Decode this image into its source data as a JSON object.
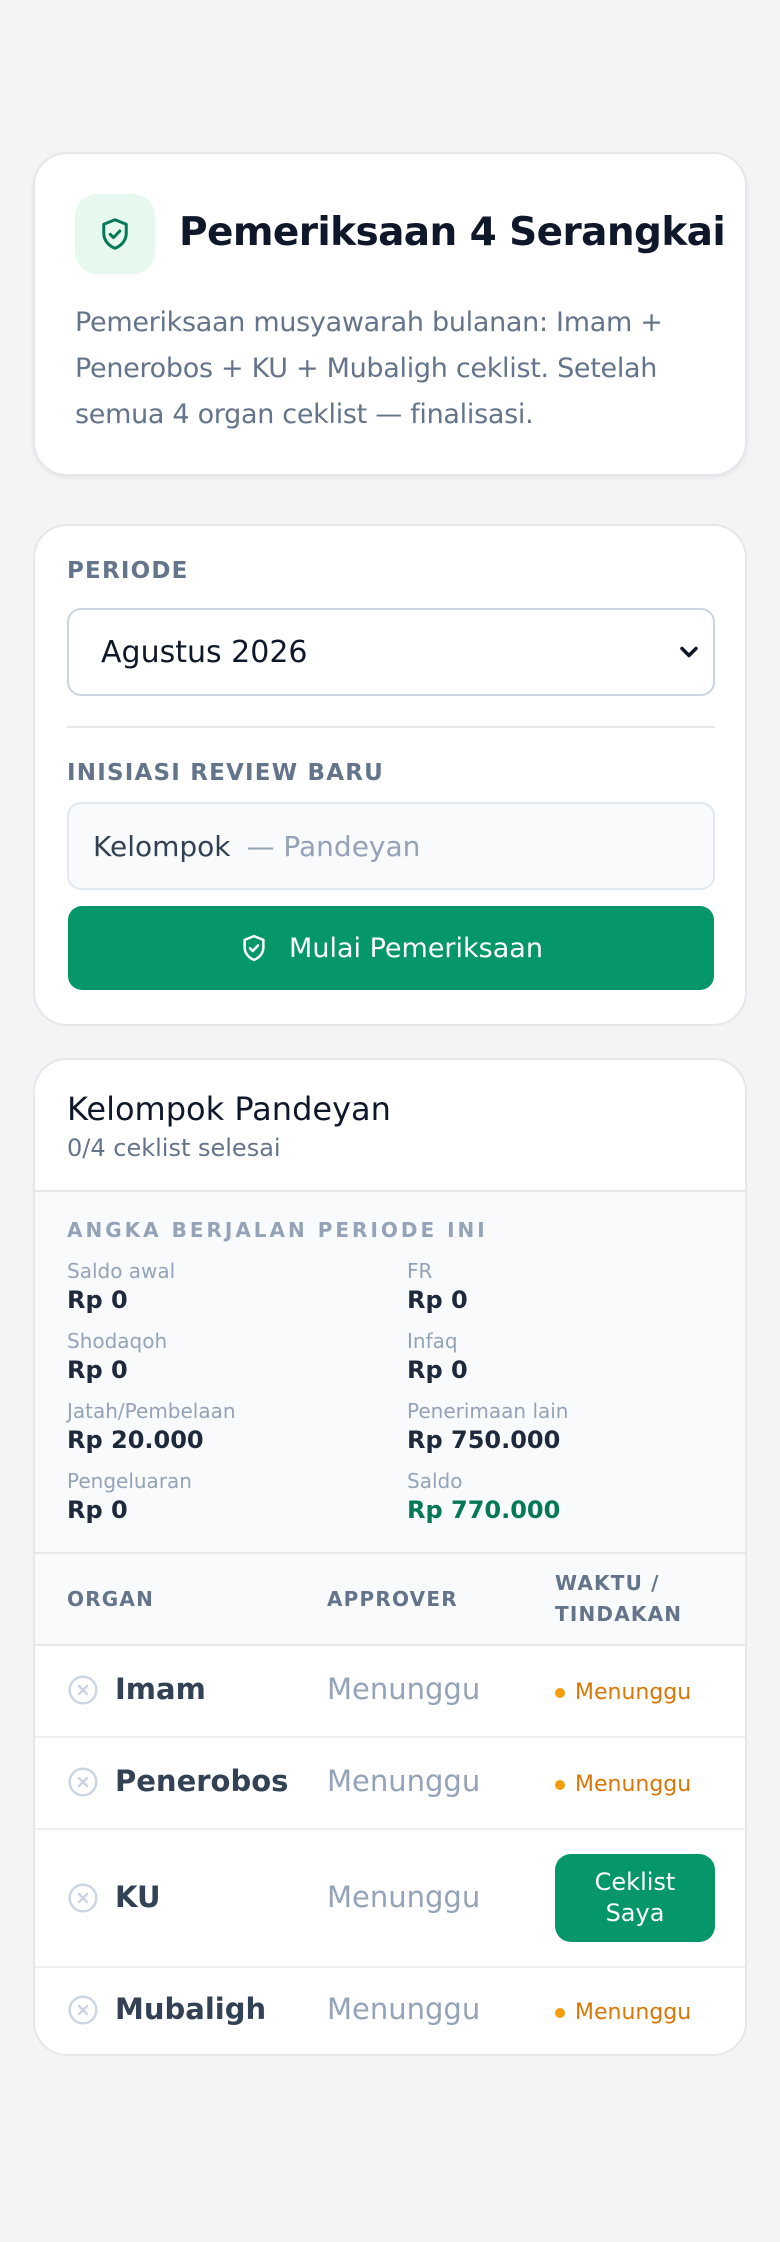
{
  "header": {
    "title": "Pemeriksaan 4 Serangkai",
    "description": "Pemeriksaan musyawarah bulanan: Imam + Penerobos + KU + Mubaligh ceklist. Setelah semua 4 organ ceklist — finalisasi."
  },
  "controls": {
    "period_label": "PERIODE",
    "period_value": "Agustus 2026",
    "new_review_label": "INISIASI REVIEW BARU",
    "group_name": "Kelompok",
    "group_suffix": "— Pandeyan",
    "start_button": "Mulai Pemeriksaan"
  },
  "group": {
    "title": "Kelompok Pandeyan",
    "progress": "0/4 ceklist selesai",
    "stats_heading": "ANGKA BERJALAN PERIODE INI",
    "stats": [
      {
        "label": "Saldo awal",
        "value": "Rp 0"
      },
      {
        "label": "FR",
        "value": "Rp 0"
      },
      {
        "label": "Shodaqoh",
        "value": "Rp 0"
      },
      {
        "label": "Infaq",
        "value": "Rp 0"
      },
      {
        "label": "Jatah/Pembelaan",
        "value": "Rp 20.000"
      },
      {
        "label": "Penerimaan lain",
        "value": "Rp 750.000"
      },
      {
        "label": "Pengeluaran",
        "value": "Rp 0"
      },
      {
        "label": "Saldo",
        "value": "Rp 770.000"
      }
    ],
    "table": {
      "headers": [
        "ORGAN",
        "APPROVER",
        "WAKTU /\nTINDAKAN"
      ],
      "rows": [
        {
          "organ": "Imam",
          "approver": "Menunggu",
          "status": "Menunggu"
        },
        {
          "organ": "Penerobos",
          "approver": "Menunggu",
          "status": "Menunggu"
        },
        {
          "organ": "KU",
          "approver": "Menunggu",
          "action": "Ceklist\nSaya"
        },
        {
          "organ": "Mubaligh",
          "approver": "Menunggu",
          "status": "Menunggu"
        }
      ]
    }
  },
  "colors": {
    "accent": "#059669",
    "pending": "#d97706",
    "saldo": "#047857"
  }
}
